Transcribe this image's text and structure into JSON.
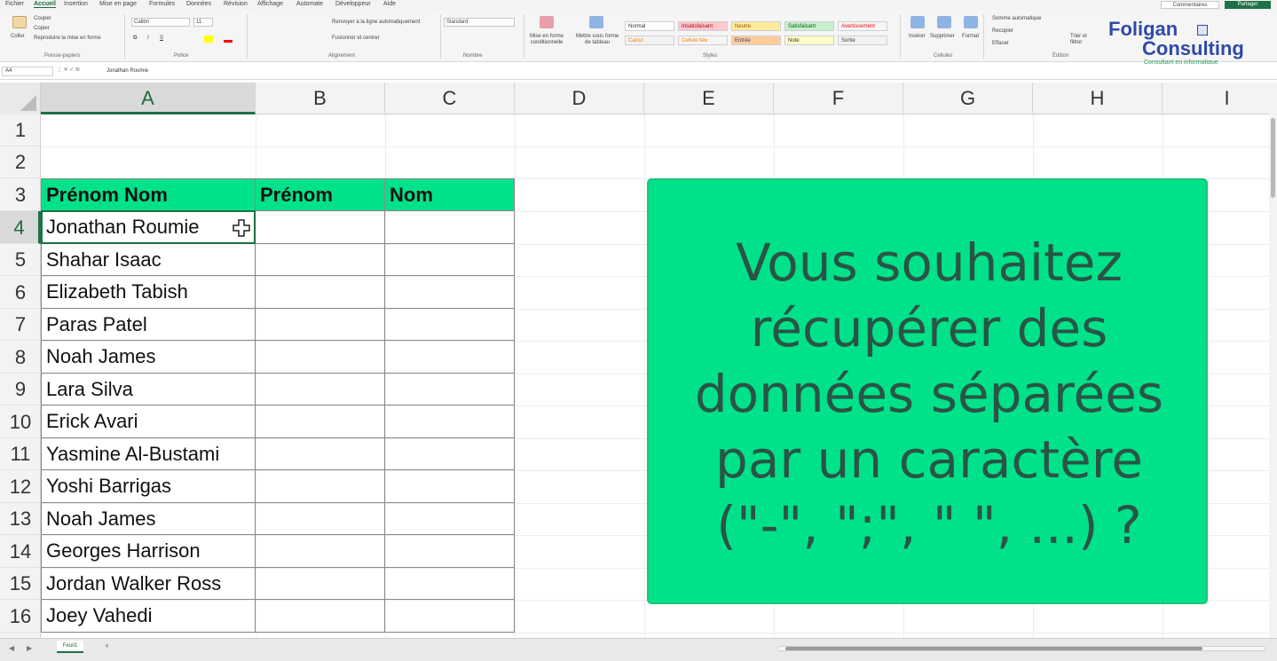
{
  "menu": {
    "items": [
      "Fichier",
      "Accueil",
      "Insertion",
      "Mise en page",
      "Formules",
      "Données",
      "Révision",
      "Affichage",
      "Automate",
      "Développeur",
      "Aide"
    ],
    "active": "Accueil",
    "comments_label": "Commentaires",
    "share_label": "Partager"
  },
  "ribbon": {
    "clipboard": {
      "paste": "Coller",
      "cut": "Couper",
      "copy": "Copier",
      "format_painter": "Reproduire la mise en forme",
      "label": "Presse-papiers"
    },
    "font": {
      "name": "Calibri",
      "size": "11",
      "bold": "G",
      "italic": "I",
      "underline": "S",
      "label": "Police"
    },
    "alignment": {
      "wrap": "Renvoyer à la ligne automatiquement",
      "merge": "Fusionner et centrer",
      "label": "Alignement"
    },
    "number": {
      "format": "Standard",
      "label": "Nombre"
    },
    "styles": {
      "conditional": "Mise en forme conditionnelle",
      "table": "Mettre sous forme de tableau",
      "cells": [
        {
          "text": "Normal",
          "bg": "#ffffff",
          "fg": "#333333"
        },
        {
          "text": "Insatisfaisant",
          "bg": "#ffc7ce",
          "fg": "#9c0006"
        },
        {
          "text": "Neutre",
          "bg": "#ffeb9c",
          "fg": "#9c5700"
        },
        {
          "text": "Satisfaisant",
          "bg": "#c6efce",
          "fg": "#006100"
        },
        {
          "text": "Avertissement",
          "bg": "#f5f5f5",
          "fg": "#ff0000"
        },
        {
          "text": "Calcul",
          "bg": "#f2f2f2",
          "fg": "#fa7d00"
        },
        {
          "text": "Cellule liée",
          "bg": "#f5f5f5",
          "fg": "#fa7d00"
        },
        {
          "text": "Entrée",
          "bg": "#ffcc99",
          "fg": "#3f3f76"
        },
        {
          "text": "Note",
          "bg": "#ffffcc",
          "fg": "#333333"
        },
        {
          "text": "Sortie",
          "bg": "#f2f2f2",
          "fg": "#3f3f3f"
        }
      ],
      "label": "Styles"
    },
    "cells": {
      "insert": "Insérer",
      "delete": "Supprimer",
      "format": "Format",
      "label": "Cellules"
    },
    "editing": {
      "autosum": "Somme automatique",
      "fill": "Recopier",
      "clear": "Effacer",
      "sort": "Trier et filtrer",
      "find": "Rechercher et sélectionner",
      "label": "Édition"
    }
  },
  "logo": {
    "line1": "Foligan",
    "line2": "Consulting",
    "line3": "Consultant en informatique"
  },
  "formula_bar": {
    "cell_ref": "A4",
    "fx": "fx",
    "value": "Jonathan Roumie"
  },
  "columns": [
    "A",
    "B",
    "C",
    "D",
    "E",
    "F",
    "G",
    "H",
    "I"
  ],
  "selected_column": "A",
  "rows": [
    "1",
    "2",
    "3",
    "4",
    "5",
    "6",
    "7",
    "8",
    "9",
    "10",
    "11",
    "12",
    "13",
    "14",
    "15",
    "16"
  ],
  "selected_row": "4",
  "table": {
    "headers": [
      "Prénom Nom",
      "Prénom",
      "Nom"
    ],
    "names": [
      "Jonathan Roumie",
      "Shahar Isaac",
      "Elizabeth Tabish",
      "Paras Patel",
      "Noah James",
      "Lara Silva",
      "Erick Avari",
      "Yasmine Al-Bustami",
      "Yoshi Barrigas",
      "Noah James",
      "Georges Harrison",
      "Jordan Walker Ross",
      "Joey Vahedi"
    ],
    "header_color": "#00e28a"
  },
  "callout": {
    "lines": [
      "Vous souhaitez",
      "récupérer des",
      "données séparées",
      "par un caractère",
      "(\"-\", \";\", \" \", ...) ?"
    ],
    "color": "#00e28a"
  },
  "sheet_tabs": {
    "tab": "Feuil1",
    "add": "+"
  }
}
